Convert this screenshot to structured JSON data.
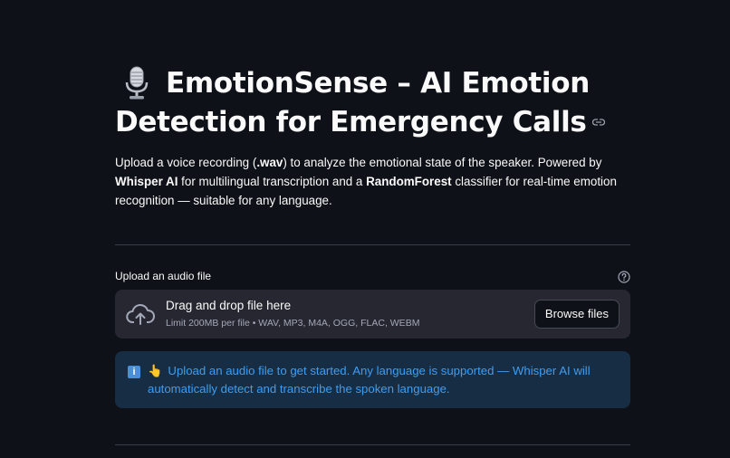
{
  "app": {
    "title_line": "EmotionSense – AI Emotion Detection for Emergency Calls",
    "title_icon": "microphone-icon",
    "anchor_icon": "link-icon"
  },
  "intro": {
    "part1": "Upload a voice recording (",
    "ext": ".wav",
    "part2": ") to analyze the emotional state of the speaker. Powered by ",
    "whisper": "Whisper AI",
    "part3": " for multilingual transcription and a ",
    "rf": "RandomForest",
    "part4": " classifier for real-time emotion recognition — suitable for any language."
  },
  "uploader": {
    "label": "Upload an audio file",
    "help_icon": "question-circle-icon",
    "drop_title": "Drag and drop file here",
    "drop_limits": "Limit 200MB per file • WAV, MP3, M4A, OGG, FLAC, WEBM",
    "browse_label": "Browse files",
    "cloud_icon": "cloud-upload-icon"
  },
  "info": {
    "icon": "info-icon",
    "icon_glyph": "i",
    "hand_glyph": "👆",
    "message": "Upload an audio file to get started. Any language is supported — Whisper AI will automatically detect and transcribe the spoken language."
  },
  "colors": {
    "background": "#0e1117",
    "dropzone": "#262730",
    "info_bg": "#172d43",
    "info_text": "#3d9df3"
  }
}
